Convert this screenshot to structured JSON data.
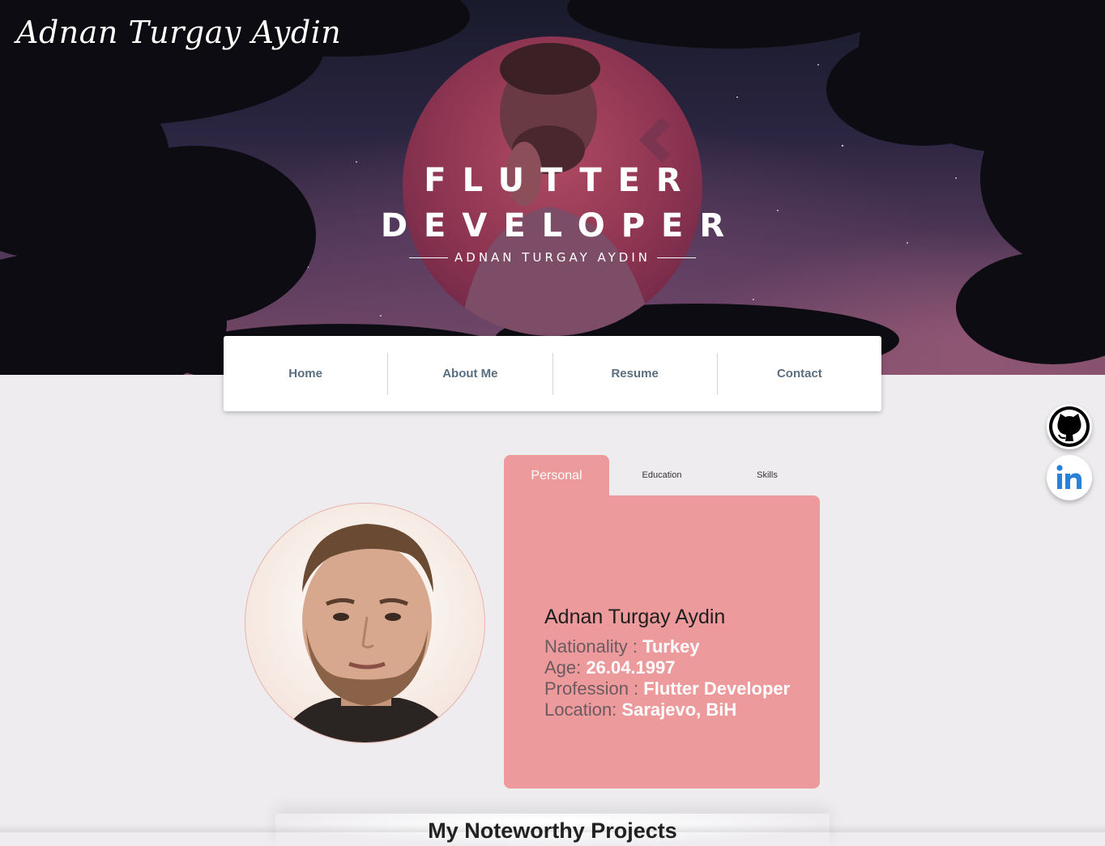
{
  "header": {
    "brand": "Adnan Turgay Aydin",
    "headline_line1": "FLUTTER",
    "headline_line2": "DEVELOPER",
    "headline_sub": "ADNAN TURGAY AYDIN"
  },
  "nav": {
    "items": [
      {
        "label": "Home"
      },
      {
        "label": "About Me"
      },
      {
        "label": "Resume"
      },
      {
        "label": "Contact"
      }
    ]
  },
  "social": [
    {
      "icon": "github-icon"
    },
    {
      "icon": "linkedin-icon",
      "color": "#2a82d6"
    }
  ],
  "profile": {
    "tabs": [
      {
        "label": "Personal",
        "active": true
      },
      {
        "label": "Education",
        "active": false
      },
      {
        "label": "Skills",
        "active": false
      }
    ],
    "name": "Adnan Turgay Aydin",
    "fields": [
      {
        "label": "Nationality : ",
        "value": "Turkey"
      },
      {
        "label": "Age: ",
        "value": "26.04.1997"
      },
      {
        "label": "Profession : ",
        "value": "Flutter Developer"
      },
      {
        "label": "Location: ",
        "value": "Sarajevo, BiH"
      }
    ],
    "card_color": "#ec9a9b"
  },
  "section": {
    "title": "My Noteworthy Projects"
  }
}
